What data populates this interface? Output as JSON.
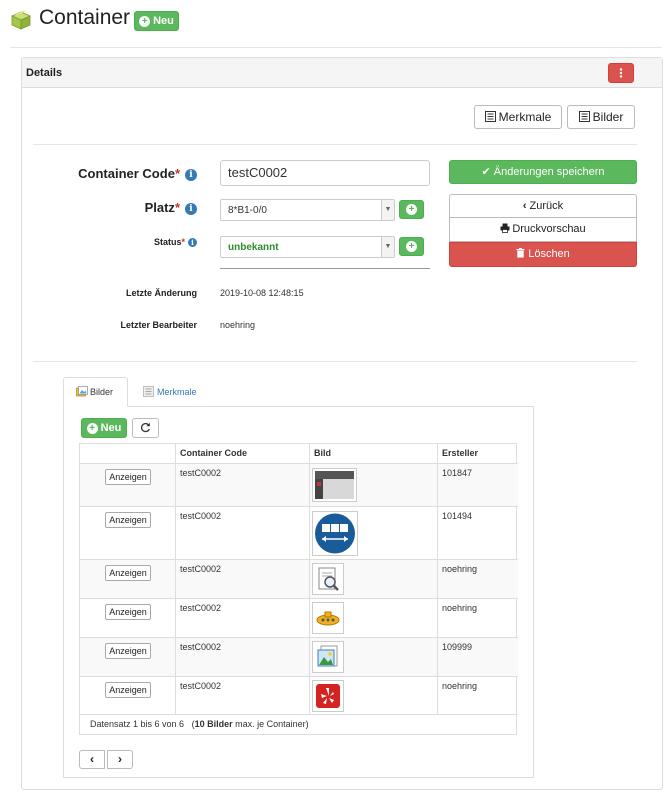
{
  "header": {
    "title": "Container",
    "new_label": "Neu"
  },
  "panel": {
    "title": "Details",
    "menu_icon": "vertical-dots-icon"
  },
  "top_buttons": {
    "features": "Merkmale",
    "images": "Bilder"
  },
  "form": {
    "code_label": "Container Code",
    "code_value": "testC0002",
    "place_label": "Platz",
    "place_value": "8*B1-0/0",
    "status_label": "Status",
    "status_value": "unbekannt",
    "last_change_label": "Letzte Änderung",
    "last_change_value": "2019-10-08 12:48:15",
    "last_editor_label": "Letzter Bearbeiter",
    "last_editor_value": "noehring",
    "required_mark": "*"
  },
  "actions": {
    "save": "Änderungen speichern",
    "back": "Zurück",
    "print": "Druckvorschau",
    "delete": "Löschen"
  },
  "tabs": [
    {
      "label": "Bilder",
      "active": true
    },
    {
      "label": "Merkmale",
      "active": false
    }
  ],
  "table": {
    "new_label": "Neu",
    "headers": [
      "",
      "Container Code",
      "Bild",
      "Ersteller"
    ],
    "show_label": "Anzeigen",
    "rows": [
      {
        "code": "testC0002",
        "image_icon": "photo-thumbnail",
        "creator": "101847"
      },
      {
        "code": "testC0002",
        "image_icon": "blue-sign-icon",
        "creator": "101494"
      },
      {
        "code": "testC0002",
        "image_icon": "document-search-icon",
        "creator": "noehring"
      },
      {
        "code": "testC0002",
        "image_icon": "submarine-icon",
        "creator": "noehring"
      },
      {
        "code": "testC0002",
        "image_icon": "picture-icon",
        "creator": "109999"
      },
      {
        "code": "testC0002",
        "image_icon": "yelp-icon",
        "creator": "noehring"
      }
    ],
    "footer_prefix": "Datensatz 1 bis 6 von 6",
    "footer_bold": "10 Bilder",
    "footer_suffix": "max. je Container)"
  },
  "colors": {
    "green": "#5cb85c",
    "red": "#d9534f",
    "blue": "#337ab7"
  }
}
